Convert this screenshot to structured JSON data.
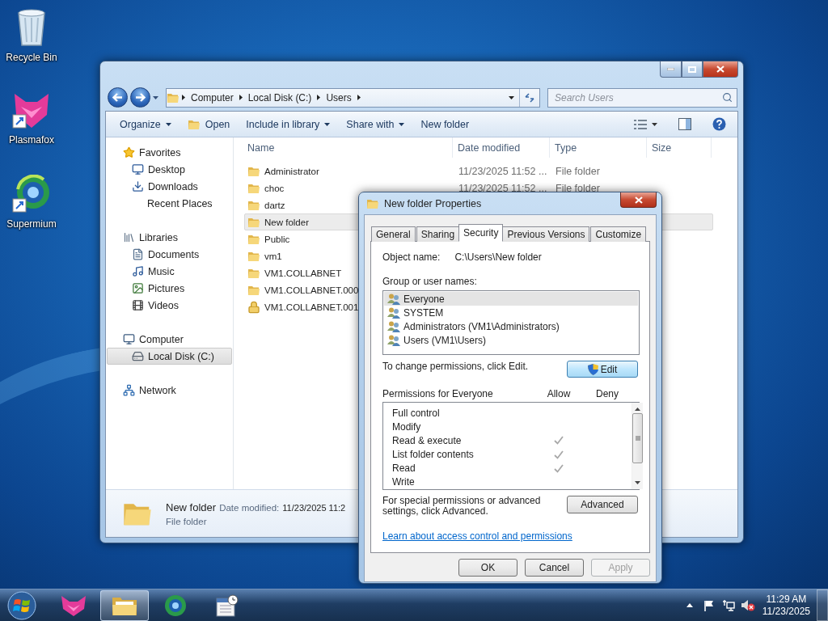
{
  "desktop_icons": [
    {
      "label": "Recycle Bin",
      "kind": "recycle"
    },
    {
      "label": "Plasmafox",
      "kind": "plasmafox"
    },
    {
      "label": "Supermium",
      "kind": "supermium"
    }
  ],
  "explorer": {
    "address": {
      "crumbs": [
        "Computer",
        "Local Disk (C:)",
        "Users"
      ]
    },
    "search": {
      "placeholder": "Search Users"
    },
    "toolbar": [
      {
        "label": "Organize",
        "kind": "menu"
      },
      {
        "label": "Open",
        "kind": "open"
      },
      {
        "label": "Include in library",
        "kind": "menu"
      },
      {
        "label": "Share with",
        "kind": "menu"
      },
      {
        "label": "New folder",
        "kind": "plain"
      }
    ],
    "nav": [
      {
        "label": "Favorites",
        "kind": "favorites",
        "selected": false,
        "children": [
          {
            "label": "Desktop",
            "kind": "desktop",
            "selected": false
          },
          {
            "label": "Downloads",
            "kind": "downloads",
            "selected": false
          },
          {
            "label": "Recent Places",
            "kind": "recent",
            "selected": false
          }
        ]
      },
      {
        "label": "Libraries",
        "kind": "libraries",
        "selected": false,
        "children": [
          {
            "label": "Documents",
            "kind": "documents",
            "selected": false
          },
          {
            "label": "Music",
            "kind": "music",
            "selected": false
          },
          {
            "label": "Pictures",
            "kind": "pictures",
            "selected": false
          },
          {
            "label": "Videos",
            "kind": "videos",
            "selected": false
          }
        ]
      },
      {
        "label": "Computer",
        "kind": "computer",
        "selected": false,
        "children": [
          {
            "label": "Local Disk (C:)",
            "kind": "drive",
            "selected": true
          }
        ]
      },
      {
        "label": "Network",
        "kind": "network",
        "selected": false
      }
    ],
    "columns": [
      "Name",
      "Date modified",
      "Type",
      "Size"
    ],
    "rows": [
      {
        "name": "Administrator",
        "date": "11/23/2025 11:52 ...",
        "type": "File folder",
        "selected": false,
        "locked": false
      },
      {
        "name": "choc",
        "date": "11/23/2025 11:52 ...",
        "type": "File folder",
        "selected": false,
        "locked": false
      },
      {
        "name": "dartz",
        "selected": false,
        "locked": false
      },
      {
        "name": "New folder",
        "selected": true,
        "locked": false
      },
      {
        "name": "Public",
        "selected": false,
        "locked": false
      },
      {
        "name": "vm1",
        "selected": false,
        "locked": false
      },
      {
        "name": "VM1.COLLABNET",
        "selected": false,
        "locked": false
      },
      {
        "name": "VM1.COLLABNET.000",
        "selected": false,
        "locked": false
      },
      {
        "name": "VM1.COLLABNET.001",
        "selected": false,
        "locked": true
      }
    ],
    "details": {
      "name": "New folder",
      "date_label": "Date modified:",
      "date": "11/23/2025 11:2",
      "type": "File folder"
    }
  },
  "dialog": {
    "title": "New folder Properties",
    "tabs": [
      {
        "label": "General",
        "selected": false
      },
      {
        "label": "Sharing",
        "selected": false
      },
      {
        "label": "Security",
        "selected": true
      },
      {
        "label": "Previous Versions",
        "selected": false
      },
      {
        "label": "Customize",
        "selected": false
      }
    ],
    "object_label": "Object name:",
    "object_value": "C:\\Users\\New folder",
    "group_label": "Group or user names:",
    "users": [
      {
        "label": "Everyone",
        "selected": true
      },
      {
        "label": "SYSTEM",
        "selected": false
      },
      {
        "label": "Administrators (VM1\\Administrators)",
        "selected": false
      },
      {
        "label": "Users (VM1\\Users)",
        "selected": false
      }
    ],
    "change_text": "To change permissions, click Edit.",
    "edit_button": "Edit",
    "permissions_label": "Permissions for Everyone",
    "allow_label": "Allow",
    "deny_label": "Deny",
    "permissions": [
      {
        "label": "Full control",
        "allow": false,
        "deny": false
      },
      {
        "label": "Modify",
        "allow": false,
        "deny": false
      },
      {
        "label": "Read & execute",
        "allow": true,
        "deny": false
      },
      {
        "label": "List folder contents",
        "allow": true,
        "deny": false
      },
      {
        "label": "Read",
        "allow": true,
        "deny": false
      },
      {
        "label": "Write",
        "allow": false,
        "deny": false
      }
    ],
    "advanced_text": "For special permissions or advanced settings, click Advanced.",
    "advanced_button": "Advanced",
    "link": "Learn about access control and permissions",
    "buttons": [
      {
        "label": "OK",
        "disabled": false
      },
      {
        "label": "Cancel",
        "disabled": false
      },
      {
        "label": "Apply",
        "disabled": true
      }
    ]
  },
  "taskbar": {
    "items": [
      {
        "kind": "plasmafox",
        "selected": false
      },
      {
        "kind": "explorer",
        "selected": true
      },
      {
        "kind": "supermium",
        "selected": false
      },
      {
        "kind": "calendar",
        "selected": false
      }
    ],
    "time": "11:29 AM",
    "date": "11/23/2025"
  }
}
